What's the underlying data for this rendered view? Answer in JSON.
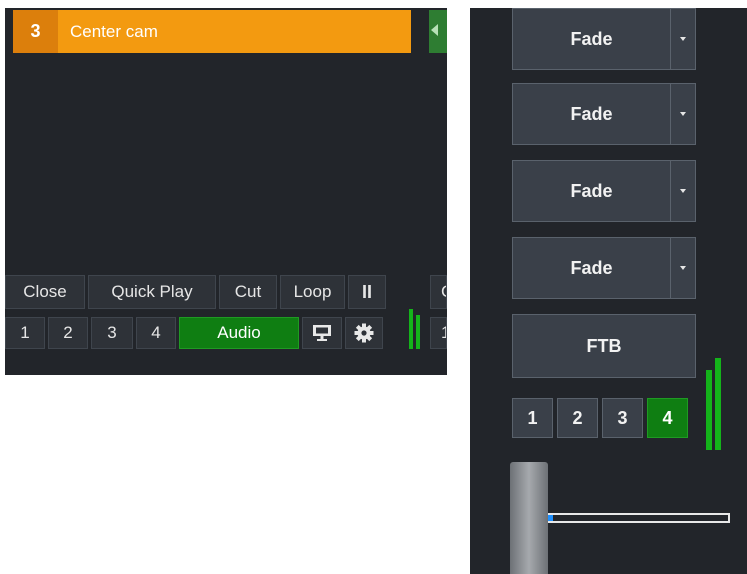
{
  "left_panel": {
    "input": {
      "number": "3",
      "name": "Center cam"
    },
    "controls": {
      "close": "Close",
      "quick_play": "Quick Play",
      "cut": "Cut",
      "loop": "Loop",
      "pause": "II",
      "edge_top": "C",
      "overlays": [
        "1",
        "2",
        "3",
        "4"
      ],
      "audio": "Audio",
      "edge_bottom": "1"
    }
  },
  "right_panel": {
    "transitions": [
      {
        "label": "Fade"
      },
      {
        "label": "Fade"
      },
      {
        "label": "Fade"
      },
      {
        "label": "Fade"
      }
    ],
    "ftb": "FTB",
    "mix_buttons": [
      "1",
      "2",
      "3",
      "4"
    ],
    "active_mix": "4",
    "t_bar_level": 0.18
  },
  "colors": {
    "background": "#22252a",
    "active_input": "#f39a10",
    "active_green": "#0f7e12",
    "tbar_fill": "#1e90ff"
  },
  "icons": [
    "monitor-icon",
    "gear-icon",
    "pause-icon",
    "chevron-down-icon"
  ]
}
